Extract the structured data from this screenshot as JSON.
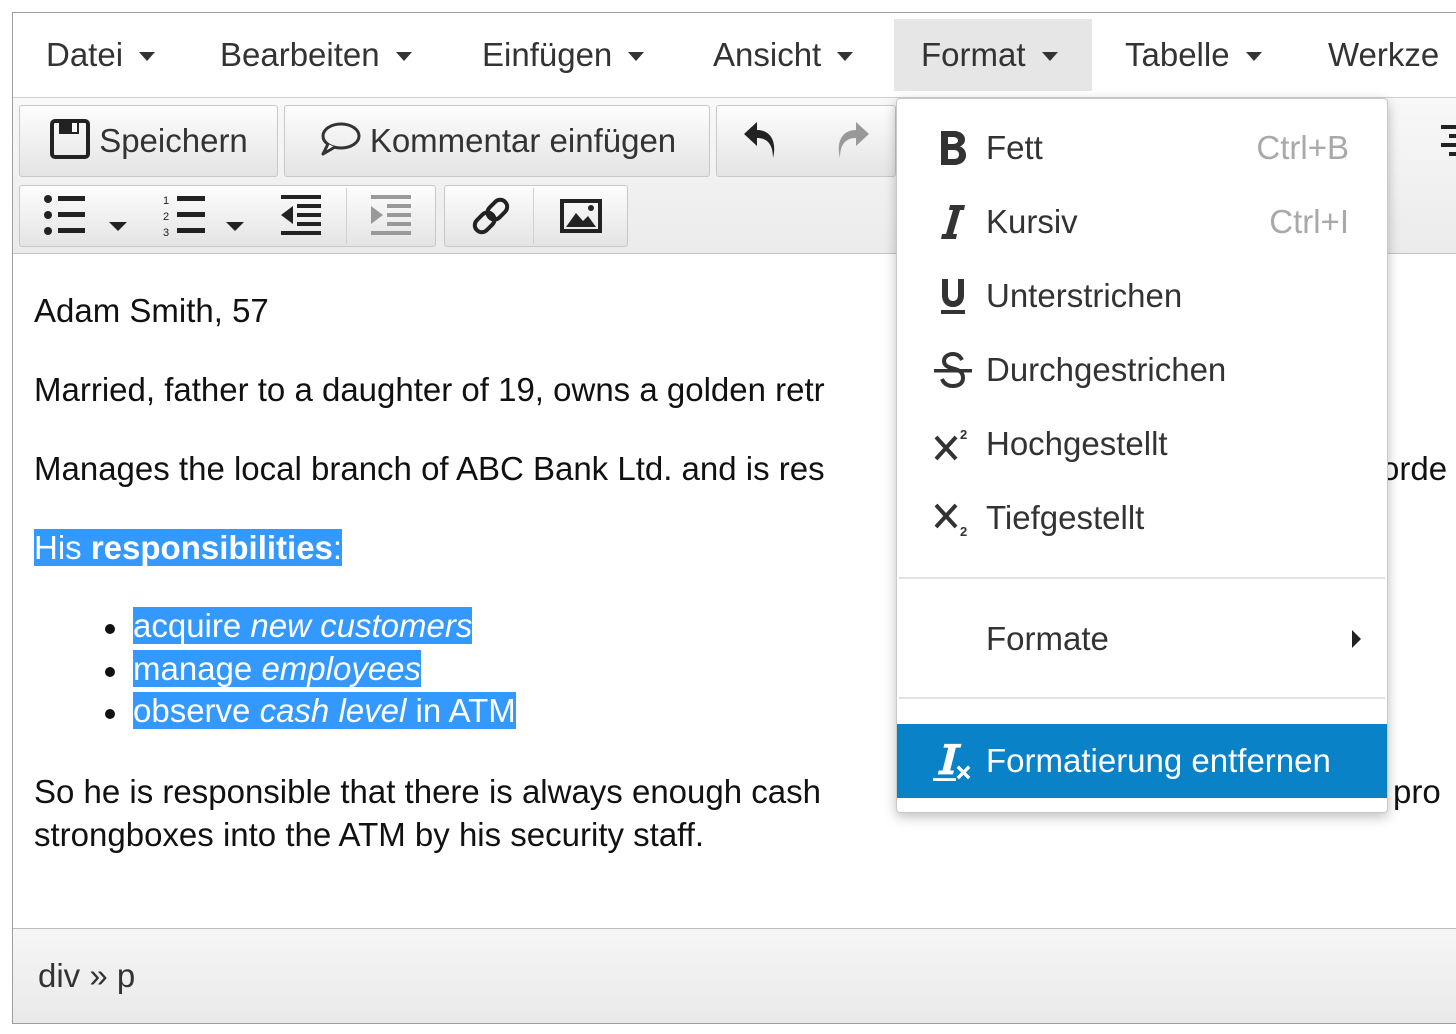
{
  "menubar": {
    "items": [
      {
        "label": "Datei"
      },
      {
        "label": "Bearbeiten"
      },
      {
        "label": "Einfügen"
      },
      {
        "label": "Ansicht"
      },
      {
        "label": "Format"
      },
      {
        "label": "Tabelle"
      },
      {
        "label": "Werkze"
      }
    ],
    "active": "Format"
  },
  "toolbar": {
    "save_label": "Speichern",
    "comment_label": "Kommentar einfügen"
  },
  "content": {
    "line1": "Adam Smith, 57",
    "line2": "Married, father to a daughter of 19, owns a golden retr",
    "line3a": "Manages the local branch of ABC Bank Ltd. and is res",
    "line3b": "orde",
    "heading_plain": "His ",
    "heading_bold": "responsibilities",
    "heading_colon": ":",
    "list": [
      {
        "plain": "acquire ",
        "italic": "new customers",
        "tail": ""
      },
      {
        "plain": "manage ",
        "italic": "employees",
        "tail": ""
      },
      {
        "plain": "observe ",
        "italic": "cash level",
        "tail": " in ATM"
      }
    ],
    "para_a": "So he is responsible that there is always enough cash",
    "para_a_tail": "pro",
    "para_b": "strongboxes into the ATM by his security staff."
  },
  "statusbar": {
    "path": "div » p"
  },
  "format_menu": {
    "items": [
      {
        "label": "Fett",
        "shortcut": "Ctrl+B",
        "icon": "bold-icon"
      },
      {
        "label": "Kursiv",
        "shortcut": "Ctrl+I",
        "icon": "italic-icon"
      },
      {
        "label": "Unterstrichen",
        "icon": "underline-icon"
      },
      {
        "label": "Durchgestrichen",
        "icon": "strikethrough-icon"
      },
      {
        "label": "Hochgestellt",
        "icon": "superscript-icon"
      },
      {
        "label": "Tiefgestellt",
        "icon": "subscript-icon"
      },
      {
        "label": "Formate",
        "icon": "chevron-right-icon"
      },
      {
        "label": "Formatierung entfernen",
        "icon": "remove-format-icon"
      }
    ],
    "highlighted": "Formatierung entfernen"
  },
  "colors": {
    "selection": "#3399ff",
    "menu_highlight": "#0a82c8",
    "shortcut_text": "#a9a9a9"
  }
}
